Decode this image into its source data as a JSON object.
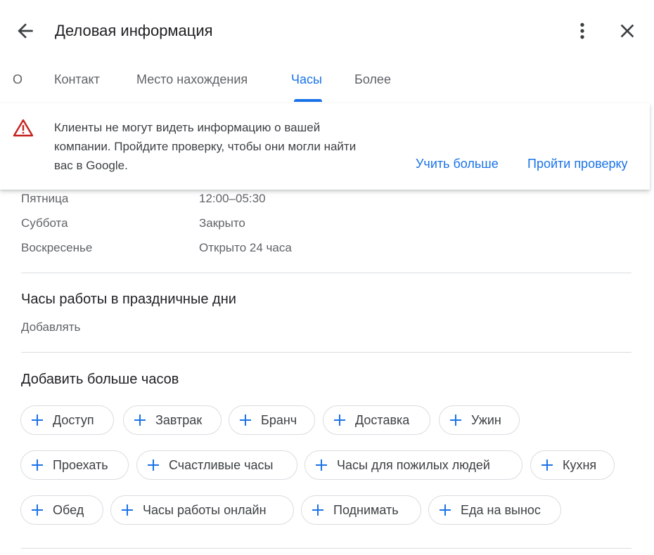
{
  "header": {
    "title": "Деловая информация",
    "back_icon": "arrow-back-icon",
    "more_icon": "more-vert-icon",
    "close_icon": "close-icon"
  },
  "tabs": [
    {
      "label": "О"
    },
    {
      "label": "Контакт"
    },
    {
      "label": "Место нахождения"
    },
    {
      "label": "Часы",
      "active": true
    },
    {
      "label": "Более"
    }
  ],
  "banner": {
    "text": "Клиенты не могут видеть информацию о вашей компании. Пройдите проверку, чтобы они могли найти вас в Google.",
    "learn_more": "Учить больше",
    "verify": "Пройти проверку",
    "icon": "warning-icon"
  },
  "hours": [
    {
      "day": "Пятница",
      "value": "12:00–05:30"
    },
    {
      "day": "Суббота",
      "value": "Закрыто"
    },
    {
      "day": "Воскресенье",
      "value": "Открыто 24 часа"
    }
  ],
  "holiday": {
    "title": "Часы работы в праздничные дни",
    "add": "Добавлять"
  },
  "more_hours": {
    "title": "Добавить больше часов",
    "chips": [
      "Доступ",
      "Завтрак",
      "Бранч",
      "Доставка",
      "Ужин",
      "Проехать",
      "Счастливые часы",
      "Часы для пожилых людей",
      "Кухня",
      "Обед",
      "Часы работы онлайн",
      "Поднимать",
      "Еда на вынос"
    ]
  },
  "colors": {
    "accent": "#1a73e8",
    "warning": "#c5221f",
    "text": "#3c4043"
  }
}
